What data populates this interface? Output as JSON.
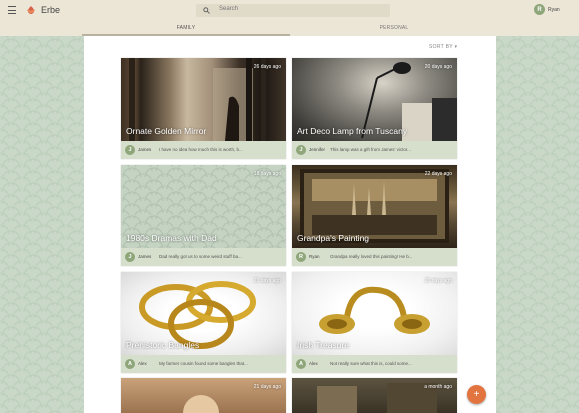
{
  "app": {
    "title": "Erbe"
  },
  "search": {
    "placeholder": "Search"
  },
  "user": {
    "name": "Ryan",
    "initial": "R"
  },
  "tabs": [
    {
      "label": "FAMILY",
      "active": true
    },
    {
      "label": "PERSONAL",
      "active": false
    }
  ],
  "sort": {
    "label": "SORT BY"
  },
  "cards": [
    {
      "title": "Ornate Golden Mirror",
      "age": "26 days ago",
      "author": "James",
      "author_initial": "J",
      "excerpt": "I have no idea how much this is worth, b..."
    },
    {
      "title": "Art Deco Lamp from Tuscany",
      "age": "20 days ago",
      "author": "Jennifer",
      "author_initial": "J",
      "excerpt": "This lamp was a gift from James' victor..."
    },
    {
      "title": "1980s Dramas with Dad",
      "age": "18 days ago",
      "author": "James",
      "author_initial": "J",
      "excerpt": "Dad really got us to some weird stuff ba..."
    },
    {
      "title": "Grandpa's Painting",
      "age": "22 days ago",
      "author": "Ryan",
      "author_initial": "R",
      "excerpt": "Grandpa really loved this painting! He b..."
    },
    {
      "title": "Prehistoric Bangles",
      "age": "21 days ago",
      "author": "Alex",
      "author_initial": "A",
      "excerpt": "My farmer cousin found some bangles that..."
    },
    {
      "title": "Irish Treasure",
      "age": "20 days ago",
      "author": "Alex",
      "author_initial": "A",
      "excerpt": "Not really sure what this is, could some..."
    },
    {
      "title": "",
      "age": "21 days ago",
      "author": "",
      "author_initial": "",
      "excerpt": ""
    },
    {
      "title": "",
      "age": "a month ago",
      "author": "",
      "author_initial": "",
      "excerpt": ""
    }
  ],
  "fab": {
    "icon": "plus-icon",
    "label": "+"
  },
  "colors": {
    "accent": "#e2743f",
    "appbar": "#ece6d6",
    "footer": "#d6dfcc",
    "avatar": "#8ea67a"
  }
}
